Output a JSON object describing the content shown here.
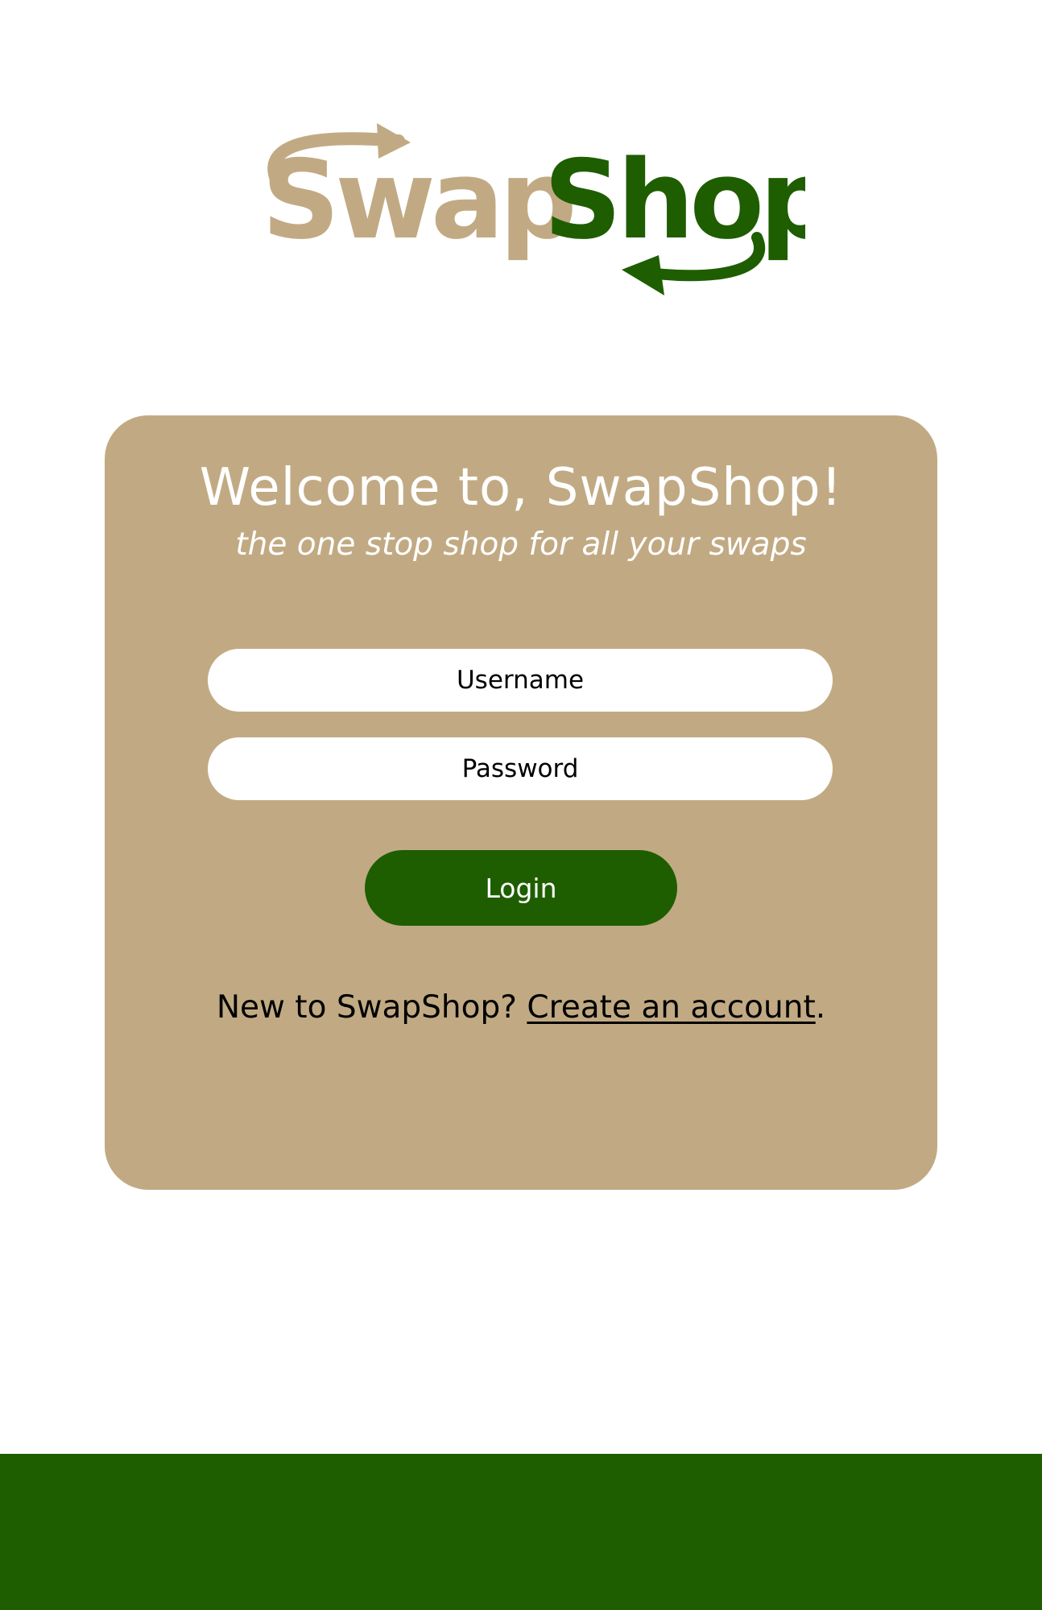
{
  "logo": {
    "word_part1": "Swap",
    "word_part2": "Shop",
    "color_part1": "#c1aa83",
    "color_part2": "#1e5e00"
  },
  "card": {
    "title": "Welcome to, SwapShop!",
    "subtitle": "the one stop shop for all your swaps",
    "background": "#c1aa83"
  },
  "form": {
    "username_placeholder": "Username",
    "password_placeholder": "Password",
    "login_label": "Login"
  },
  "signup": {
    "prompt": "New to SwapShop? ",
    "link_text": "Create an account",
    "suffix": "."
  },
  "colors": {
    "accent_green": "#1e5e00",
    "tan": "#c1aa83"
  }
}
